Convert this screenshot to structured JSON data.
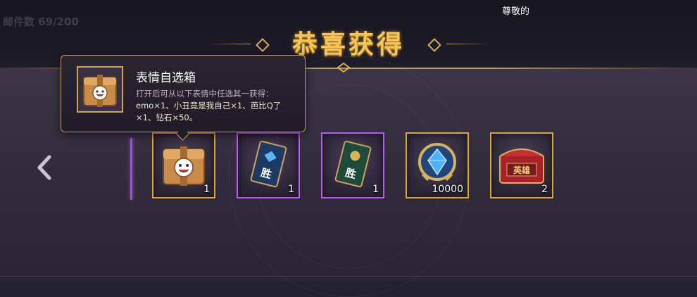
{
  "header": {
    "title": "恭喜获得",
    "top_right_text": "尊敬的",
    "background_counter": "邮件数 69/200"
  },
  "tooltip": {
    "item_name": "表情自选箱",
    "description_intro": "打开后可从以下表情中任选其一获得：",
    "description_items": "emo×1、小丑竟是我自己×1、芭比Q了×1、钻石×50。"
  },
  "rewards": [
    {
      "name": "表情自选箱",
      "quantity": "1",
      "icon": "emoji-chest-icon",
      "rarity": "gold"
    },
    {
      "name": "胜利卡（蓝）",
      "quantity": "1",
      "icon": "victory-card-blue-icon",
      "rarity": "purple"
    },
    {
      "name": "胜利卡（绿）",
      "quantity": "1",
      "icon": "victory-card-green-icon",
      "rarity": "purple"
    },
    {
      "name": "钻石",
      "quantity": "10000",
      "icon": "diamond-icon",
      "rarity": "gold"
    },
    {
      "name": "英雄宝箱",
      "quantity": "2",
      "icon": "hero-chest-icon",
      "rarity": "gold",
      "label": "英雄"
    }
  ],
  "colors": {
    "gold_border": "#d7a548",
    "purple_border": "#b360e6",
    "title_gold": "#f4c55a"
  }
}
